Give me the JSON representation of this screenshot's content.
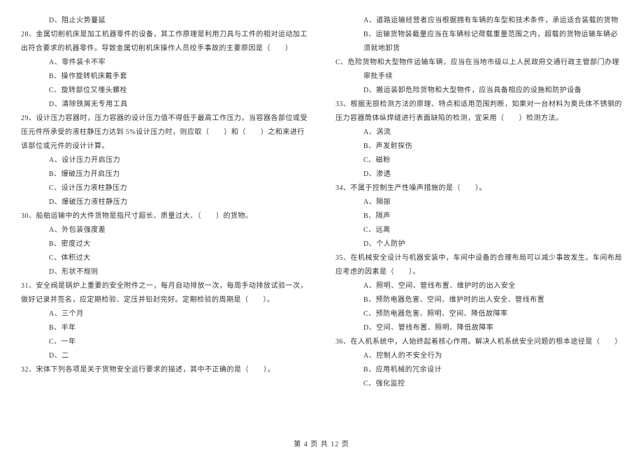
{
  "left": {
    "opt_27d": "D、阻止火势蔓延",
    "q28": "28、金属切削机床是加工机器零件的设备，其工作原理是利用刀具与工件的相对运动加工出符合要求的机器零件。导致金属切削机床操作人员绞手事故的主要原因是（　　）",
    "q28_opts": [
      "A、零件装卡不牢",
      "B、操作旋转机床戴手套",
      "C、旋转部位又埋头螺栓",
      "D、清除铁屑无专用工具"
    ],
    "q29": "29、设计压力容器时，压力容器的设计压力值不得低于最高工作压力。当容器各部位或受压元件所承受的液柱静压力达到 5%设计压力时，则应取（　　）和（　　）之和来进行该部位或元件的设计计算。",
    "q29_opts": [
      "A、设计压力开启压力",
      "B、爆破压力开启压力",
      "C、设计压力液柱静压力",
      "D、爆破压力液柱静压力"
    ],
    "q30": "30、船舶运输中的大件货物是指尺寸超长、质量过大、（　　）的货物。",
    "q30_opts": [
      "A、外包装强度差",
      "B、密度过大",
      "C、体积过大",
      "D、形状不规则"
    ],
    "q31": "31、安全阀是锅炉上重要的安全附件之一，每月自动排放一次，每周手动排放试验一次，做好记录并签名，应定期检验、定压并铅封完好。定期检验的周期是（　　）。",
    "q31_opts": [
      "A、三个月",
      "B、半年",
      "C、一年",
      "D、二"
    ],
    "q32": "32、宋体下列各项是关于货物安全运行要求的描述，其中不正确的是（　　）。"
  },
  "right": {
    "q32_opts": [
      "A、道路运输经营者应当根据拥有车辆的车型和技术条件，承运适合装载的货物",
      "B、运输货物装截量应当在车辆标记荷载重量范围之内，超载的货物运输车辆必须就地卸货",
      "C、危险货物和大型物件运输车辆，应当在当地市级以上人民政府交通行政主管部门办理审批手续",
      "D、搬运装卸危险货物和大型物件，应当具备相应的设施和防护设备"
    ],
    "q33": "33、根据无损检测方法的原理、特点和适用范围判断，如果对一台材料为奥氏体不锈钢的压力容器筒体纵焊缝进行表面缺陷的检测，宜采用（　　）检测方法。",
    "q33_opts": [
      "A、涡流",
      "B、声发射探伤",
      "C、磁粉",
      "D、渗透"
    ],
    "q34": "34、不属于控制生产性噪声措施的是（　　）。",
    "q34_opts": [
      "A、隔振",
      "B、隔声",
      "C、远离",
      "D、个人防护"
    ],
    "q35": "35、在机械安全设计与机器安装中，车间中设备的合理布局可以减少事故发生。车间布局应考虑的因素是（　　）。",
    "q35_opts": [
      "A、照明、空间、管线布置、维护时的出入安全",
      "B、预防电器危害、空间、维护时的出人安全、管线布置",
      "C、预防电器危害、照明、空间、降低故障率",
      "D、空间、管线布置、照明、降低故障率"
    ],
    "q36": "36、在人机系统中，人始终起着核心作用。解决人机系统安全问题的根本途径是（　　）",
    "q36_opts": [
      "A、控制人的不安全行为",
      "B、应用机械的冗余设计",
      "C、强化监控"
    ]
  },
  "footer": "第 4 页 共 12 页"
}
